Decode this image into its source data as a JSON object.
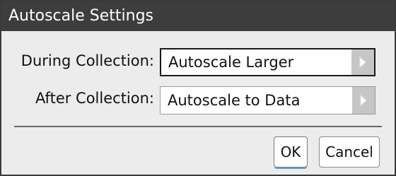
{
  "dialog": {
    "title": "Autoscale Settings"
  },
  "during": {
    "label": "During Collection:",
    "value": "Autoscale Larger"
  },
  "after": {
    "label": "After Collection:",
    "value": "Autoscale to Data"
  },
  "buttons": {
    "ok": "OK",
    "cancel": "Cancel"
  },
  "colors": {
    "titlebar": "#3d3d3d",
    "dialog_bg": "#ececec",
    "ok_focus": "#5aa0d8"
  },
  "icons": {
    "dropdown": "triangle-right-icon"
  }
}
